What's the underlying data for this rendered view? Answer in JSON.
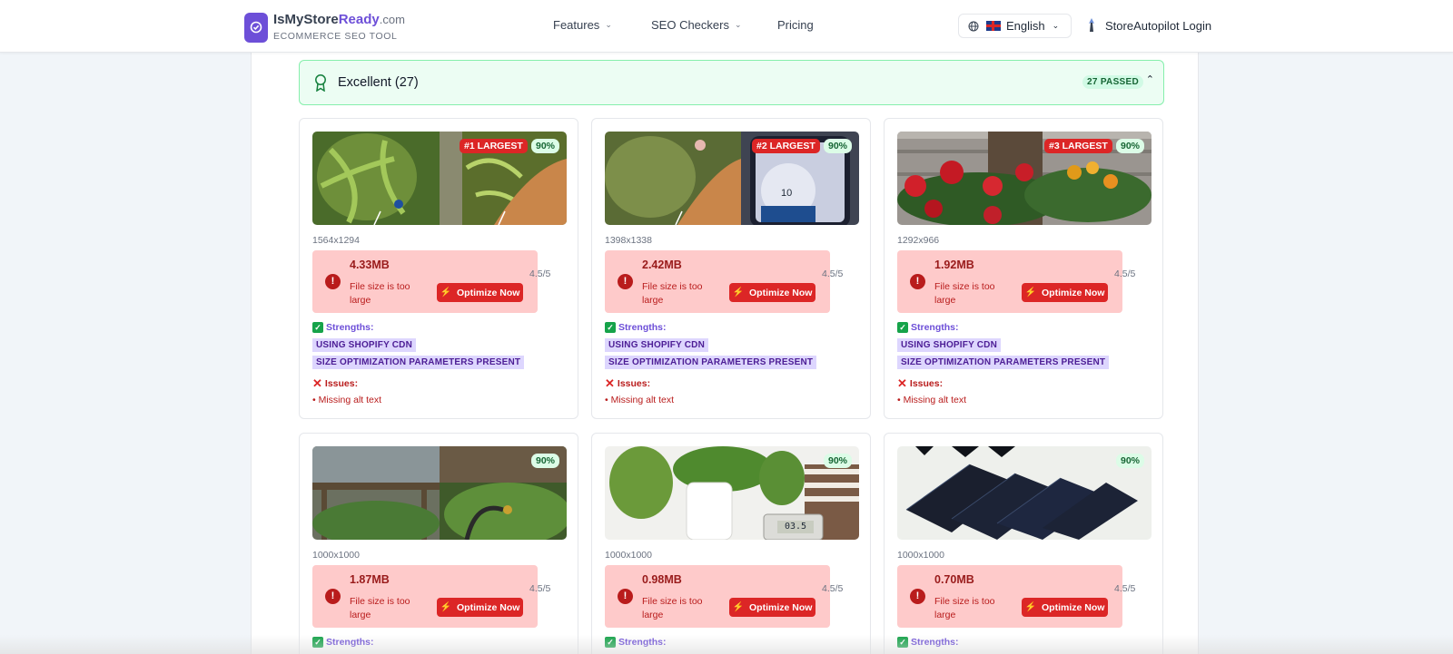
{
  "header": {
    "logo_name_prefix": "IsMyStore",
    "logo_name_accent": "Ready",
    "logo_domain": ".com",
    "logo_tagline": "ECOMMERCE SEO TOOL",
    "nav": {
      "features": "Features",
      "seo_checkers": "SEO Checkers",
      "pricing": "Pricing"
    },
    "language": "English",
    "login": "StoreAutopilot Login"
  },
  "section": {
    "title": "Excellent (27)",
    "passed_badge": "27 PASSED"
  },
  "labels": {
    "optimize": "Optimize Now",
    "file_msg": "File size is too large",
    "strengths": "Strengths:",
    "issues": "Issues:"
  },
  "cards": [
    {
      "rank": "#1 LARGEST",
      "score": "90%",
      "dims": "1564x1294",
      "size": "4.33MB",
      "rating": "4.5/5",
      "strengths": [
        "USING SHOPIFY CDN",
        "SIZE OPTIMIZATION PARAMETERS PRESENT"
      ],
      "issues": [
        "• Missing alt text"
      ]
    },
    {
      "rank": "#2 LARGEST",
      "score": "90%",
      "dims": "1398x1338",
      "size": "2.42MB",
      "rating": "4.5/5",
      "strengths": [
        "USING SHOPIFY CDN",
        "SIZE OPTIMIZATION PARAMETERS PRESENT"
      ],
      "issues": [
        "• Missing alt text"
      ]
    },
    {
      "rank": "#3 LARGEST",
      "score": "90%",
      "dims": "1292x966",
      "size": "1.92MB",
      "rating": "4.5/5",
      "strengths": [
        "USING SHOPIFY CDN",
        "SIZE OPTIMIZATION PARAMETERS PRESENT"
      ],
      "issues": [
        "• Missing alt text"
      ]
    },
    {
      "rank": "",
      "score": "90%",
      "dims": "1000x1000",
      "size": "1.87MB",
      "rating": "4.5/5",
      "strengths": [],
      "issues": []
    },
    {
      "rank": "",
      "score": "90%",
      "dims": "1000x1000",
      "size": "0.98MB",
      "rating": "4.5/5",
      "strengths": [],
      "issues": []
    },
    {
      "rank": "",
      "score": "90%",
      "dims": "1000x1000",
      "size": "0.70MB",
      "rating": "4.5/5",
      "strengths": [],
      "issues": []
    }
  ],
  "thumbnail_overlay_text": {
    "timer_display": "10",
    "meter_display": "03.5"
  },
  "colors": {
    "brand": "#6d4fd8",
    "excellent_bg": "#ecfdf3",
    "error": "#dc2626",
    "score_badge": "#dcfce7"
  }
}
